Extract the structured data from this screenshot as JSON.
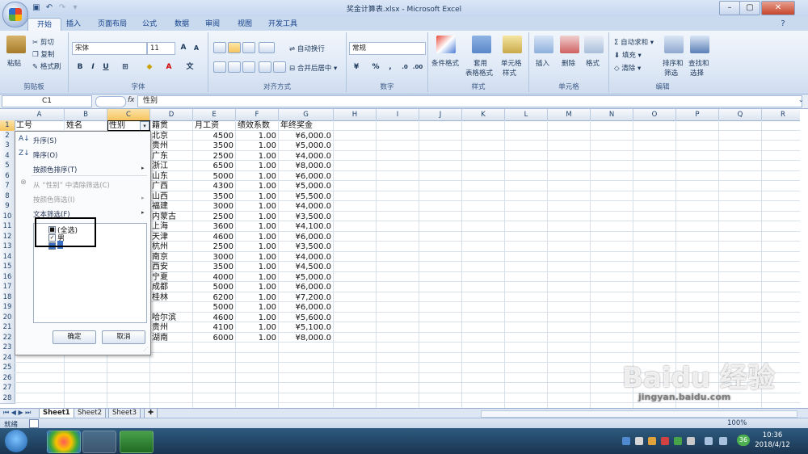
{
  "window": {
    "title": "奖金计算表.xlsx - Microsoft Excel",
    "minimize": "–",
    "restore": "▢",
    "close": "✕"
  },
  "tabs": [
    "开始",
    "插入",
    "页面布局",
    "公式",
    "数据",
    "审阅",
    "视图",
    "开发工具"
  ],
  "ribbon": {
    "clipboard": {
      "paste": "粘贴",
      "cut": "剪切",
      "copy": "复制",
      "format_painter": "格式刷",
      "label": "剪贴板"
    },
    "font": {
      "name": "宋体",
      "size": "11",
      "grow": "A",
      "shrink": "A",
      "bold": "B",
      "italic": "I",
      "underline": "U",
      "color_a": "A",
      "label": "字体"
    },
    "alignment": {
      "wrap": "自动换行",
      "merge": "合并后居中",
      "label": "对齐方式"
    },
    "number": {
      "format": "常规",
      "percent": "%",
      "comma": ",",
      "label": "数字"
    },
    "styles": {
      "conditional": "条件格式",
      "table": "套用\n表格格式",
      "table1": "套用",
      "table2": "表格格式",
      "cell": "单元格\n样式",
      "cell1": "单元格",
      "cell2": "样式",
      "label": "样式"
    },
    "cells": {
      "insert": "插入",
      "delete": "删除",
      "format": "格式",
      "label": "单元格"
    },
    "editing": {
      "autosum": "自动求和",
      "fill": "填充",
      "clear": "清除",
      "sort1": "排序和",
      "sort2": "筛选",
      "find1": "查找和",
      "find2": "选择",
      "label": "编辑"
    }
  },
  "formula_bar": {
    "name_box": "C1",
    "fx": "fx",
    "value": "性别"
  },
  "columns": [
    "A",
    "B",
    "C",
    "D",
    "E",
    "F",
    "G",
    "H",
    "I",
    "J",
    "K",
    "L",
    "M",
    "N",
    "O",
    "P",
    "Q",
    "R"
  ],
  "rows": [
    "1",
    "2",
    "3",
    "4",
    "5",
    "6",
    "7",
    "8",
    "9",
    "10",
    "11",
    "12",
    "13",
    "14",
    "15",
    "16",
    "17",
    "18",
    "19",
    "20",
    "21",
    "22",
    "23",
    "24",
    "25",
    "26",
    "27",
    "28"
  ],
  "headers": {
    "a": "工号",
    "b": "姓名",
    "c": "性别",
    "d": "籍贯",
    "e": "月工资",
    "f": "绩效系数",
    "g": "年终奖金"
  },
  "data_rows": [
    {
      "d": "北京",
      "e": "4500",
      "f": "1.00",
      "g": "¥6,000.0"
    },
    {
      "d": "贵州",
      "e": "3500",
      "f": "1.00",
      "g": "¥5,000.0"
    },
    {
      "d": "广东",
      "e": "2500",
      "f": "1.00",
      "g": "¥4,000.0"
    },
    {
      "d": "浙江",
      "e": "6500",
      "f": "1.00",
      "g": "¥8,000.0"
    },
    {
      "d": "山东",
      "e": "5000",
      "f": "1.00",
      "g": "¥6,000.0"
    },
    {
      "d": "广西",
      "e": "4300",
      "f": "1.00",
      "g": "¥5,000.0"
    },
    {
      "d": "山西",
      "e": "3500",
      "f": "1.00",
      "g": "¥5,500.0"
    },
    {
      "d": "福建",
      "e": "3000",
      "f": "1.00",
      "g": "¥4,000.0"
    },
    {
      "d": "内蒙古",
      "e": "2500",
      "f": "1.00",
      "g": "¥3,500.0"
    },
    {
      "d": "上海",
      "e": "3600",
      "f": "1.00",
      "g": "¥4,100.0"
    },
    {
      "d": "天津",
      "e": "4600",
      "f": "1.00",
      "g": "¥6,000.0"
    },
    {
      "d": "杭州",
      "e": "2500",
      "f": "1.00",
      "g": "¥3,500.0"
    },
    {
      "d": "南京",
      "e": "3000",
      "f": "1.00",
      "g": "¥4,000.0"
    },
    {
      "d": "西安",
      "e": "3500",
      "f": "1.00",
      "g": "¥4,500.0"
    },
    {
      "d": "宁夏",
      "e": "4000",
      "f": "1.00",
      "g": "¥5,000.0"
    },
    {
      "d": "成都",
      "e": "5000",
      "f": "1.00",
      "g": "¥6,000.0"
    },
    {
      "d": "桂林",
      "e": "6200",
      "f": "1.00",
      "g": "¥7,200.0"
    },
    {
      "d": "",
      "e": "5000",
      "f": "1.00",
      "g": "¥6,000.0"
    },
    {
      "d": "哈尔滨",
      "e": "4600",
      "f": "1.00",
      "g": "¥5,600.0"
    },
    {
      "d": "贵州",
      "e": "4100",
      "f": "1.00",
      "g": "¥5,100.0"
    },
    {
      "d": "湖南",
      "e": "6000",
      "f": "1.00",
      "g": "¥8,000.0"
    }
  ],
  "filter_menu": {
    "sort_asc": "升序(S)",
    "sort_desc": "降序(O)",
    "sort_color": "按颜色排序(T)",
    "clear_filter": "从 “性别” 中清除筛选(C)",
    "filter_color": "按颜色筛选(I)",
    "text_filter": "文本筛选(F)",
    "select_all": "(全选)",
    "male": "男",
    "female": "女",
    "ok": "确定",
    "cancel": "取消"
  },
  "sheets": [
    "Sheet1",
    "Sheet2",
    "Sheet3"
  ],
  "status": {
    "ready": "就绪",
    "zoom": "100%"
  },
  "taskbar": {
    "time": "10:36",
    "date": "2018/4/12",
    "badge": "36"
  },
  "watermark": "Baidu 经验",
  "watermark_sub": "jingyan.baidu.com"
}
